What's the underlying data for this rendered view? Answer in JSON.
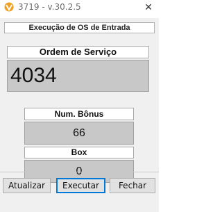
{
  "window": {
    "title": "3719 - v.30.2.5",
    "close_glyph": "✕",
    "icon": "app-logo-icon"
  },
  "form": {
    "header": "Execução de OS de Entrada",
    "ordem_servico": {
      "label": "Ordem de Serviço",
      "value": "4034"
    },
    "num_bonus": {
      "label": "Num. Bônus",
      "value": "66"
    },
    "box": {
      "label": "Box",
      "value": "0"
    }
  },
  "buttons": {
    "atualizar": "Atualizar",
    "executar": "Executar",
    "fechar": "Fechar"
  },
  "colors": {
    "accent": "#0078d7",
    "logo": "#f0a020",
    "field_bg": "#c8c8c8"
  }
}
